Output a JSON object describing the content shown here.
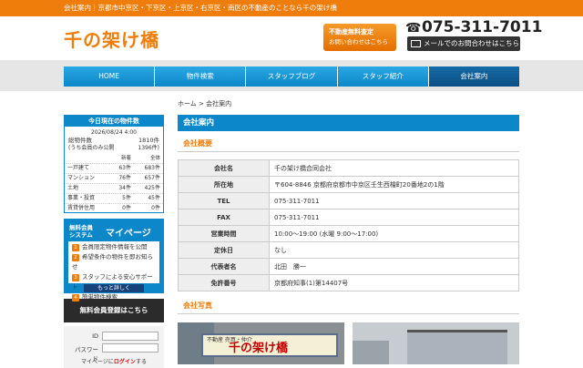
{
  "topbar": {
    "text": "会社案内｜京都市中京区・下京区・上京区・右京区・南区の不動産のことなら千の架け橋"
  },
  "header": {
    "logo": "千の架け橋",
    "assess_button": {
      "line1": "不動産無料査定",
      "line2": "お問い合わせはこちら"
    },
    "tel": "075-311-7011",
    "mail_button": "メールでのお問合わせはこちら"
  },
  "nav": {
    "items": [
      "HOME",
      "物件検索",
      "スタッフブログ",
      "スタッフ紹介",
      "会社案内"
    ],
    "active": "会社案内"
  },
  "breadcrumb": {
    "home": "ホーム",
    "sep": " > ",
    "current": "会社案内"
  },
  "page_title": "会社案内",
  "section_overview": "会社概要",
  "company": {
    "rows": [
      {
        "key": "会社名",
        "value": "千の架け橋合同会社"
      },
      {
        "key": "所在地",
        "value": "〒604-8846 京都府京都市中京区壬生西檜町20番地2の1階"
      },
      {
        "key": "TEL",
        "value": "075-311-7011"
      },
      {
        "key": "FAX",
        "value": "075-311-7011"
      },
      {
        "key": "営業時間",
        "value": "10:00〜19:00 (水曜 9:00〜17:00)"
      },
      {
        "key": "定休日",
        "value": "なし"
      },
      {
        "key": "代表者名",
        "value": "北田　勝一"
      },
      {
        "key": "免許番号",
        "value": "京都府知事(1)第14407号"
      }
    ]
  },
  "section_photos": "会社写真",
  "photo_sign": {
    "small": "不動産\n売買・仲介",
    "large": "千の架け橋"
  },
  "stock": {
    "title": "今日現在の物件数",
    "date": "2026/08/24 4:00",
    "total_label": "総物件数",
    "total_value": "1810件",
    "member_label": "(うち会員のみ公開",
    "member_value": "1396件)",
    "col_new": "新着",
    "col_all": "全体",
    "rows": [
      {
        "type": "一戸建て",
        "new": "63件",
        "all": "683件"
      },
      {
        "type": "マンション",
        "new": "76件",
        "all": "657件"
      },
      {
        "type": "土地",
        "new": "34件",
        "all": "425件"
      },
      {
        "type": "事業・投資",
        "new": "5件",
        "all": "45件"
      },
      {
        "type": "賃貸併住用",
        "new": "0件",
        "all": "0件"
      }
    ]
  },
  "mypage": {
    "head1": "無料会員",
    "head2": "システム",
    "title": "マイページ",
    "items": [
      "会員限定物件情報を公開",
      "希望条件の物件を即お知らせ",
      "スタッフによる安心サポート",
      "簡単物件検索"
    ],
    "more": "もっと詳しく"
  },
  "register_button": "無料会員登録はこちら",
  "login": {
    "id_label": "ID",
    "pw_label": "パスワード",
    "link_prefix": "マイページに",
    "link_text": "ログイン",
    "link_suffix": "する"
  }
}
